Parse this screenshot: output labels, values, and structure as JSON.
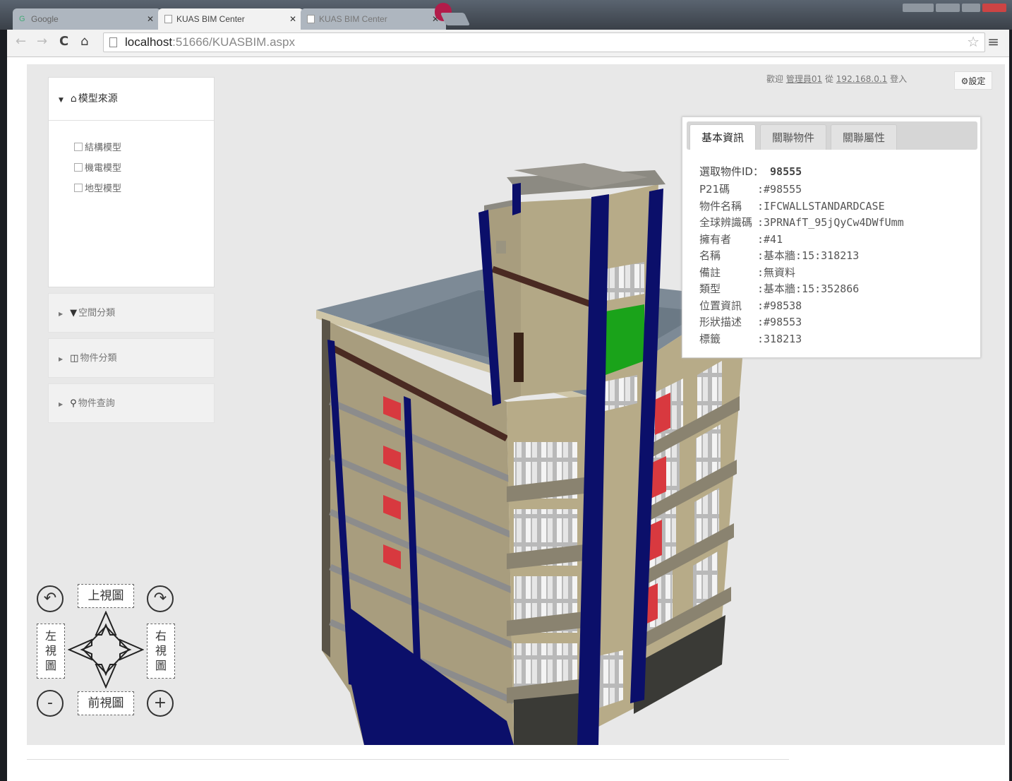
{
  "browser": {
    "tabs": [
      {
        "label": "Google",
        "active": false
      },
      {
        "label": "KUAS BIM Center",
        "active": true
      },
      {
        "label": "KUAS BIM Center",
        "active": false
      }
    ],
    "url_host": "localhost",
    "url_rest": ":51666/KUASBIM.aspx"
  },
  "userbar": {
    "prefix": "歡迎",
    "user": "管理員01",
    "from": "從",
    "ip": "192.168.0.1",
    "suffix": "登入",
    "settings_label": "設定"
  },
  "sidebar": {
    "source_title": "模型來源",
    "models": [
      "結構模型",
      "機電模型",
      "地型模型"
    ],
    "sections": [
      {
        "icon": "filter-icon",
        "label": "空間分類"
      },
      {
        "icon": "cube-icon",
        "label": "物件分類"
      },
      {
        "icon": "search-icon",
        "label": "物件查詢"
      }
    ]
  },
  "info_panel": {
    "tabs": [
      "基本資訊",
      "關聯物件",
      "關聯屬性"
    ],
    "selected_label": "選取物件ID：",
    "selected_id": "98555",
    "fields": [
      {
        "key": "P21碼",
        "value": ":#98555"
      },
      {
        "key": "物件名稱",
        "value": ":IFCWALLSTANDARDCASE"
      },
      {
        "key": "全球辨識碼",
        "value": ":3PRNAfT_95jQyCw4DWfUmm"
      },
      {
        "key": "擁有者",
        "value": ":#41"
      },
      {
        "key": "名稱",
        "value": ":基本牆:15:318213"
      },
      {
        "key": "備註",
        "value": ":無資料"
      },
      {
        "key": "類型",
        "value": ":基本牆:15:352866"
      },
      {
        "key": "位置資訊",
        "value": ":#98538"
      },
      {
        "key": "形狀描述",
        "value": ":#98553"
      },
      {
        "key": "標籤",
        "value": ":318213"
      }
    ]
  },
  "view_controls": {
    "top_view": "上視圖",
    "front_view": "前視圖",
    "left_view": "左視圖",
    "right_view": "右視圖",
    "zoom_out": "-",
    "zoom_in": "+"
  },
  "colors": {
    "wall": "#a89d7e",
    "column": "#0b0f6a",
    "roof": "#7d8a96",
    "highlight": "#1aa31a",
    "window_red": "#d8393f",
    "beam": "#4a2a22"
  }
}
